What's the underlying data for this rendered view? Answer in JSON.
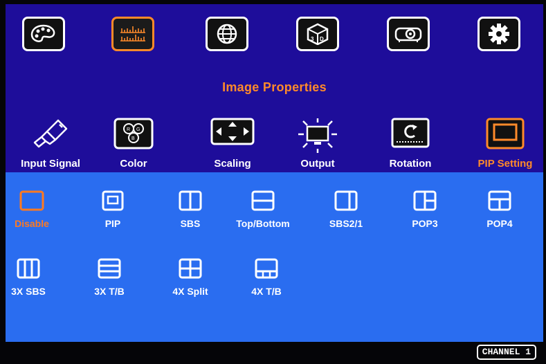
{
  "top_menu": [
    {
      "name": "palette-icon"
    },
    {
      "name": "image-adjust-icon",
      "active": true
    },
    {
      "name": "globe-icon"
    },
    {
      "name": "cube-3d-icon"
    },
    {
      "name": "projector-icon"
    },
    {
      "name": "gear-icon"
    }
  ],
  "section_title": "Image Properties",
  "categories": [
    {
      "label": "Input Signal",
      "icon": "usb-cable-icon"
    },
    {
      "label": "Color",
      "icon": "rgb-circles-icon"
    },
    {
      "label": "Scaling",
      "icon": "scaling-arrows-icon"
    },
    {
      "label": "Output",
      "icon": "monitor-glow-icon"
    },
    {
      "label": "Rotation",
      "icon": "rotation-icon"
    },
    {
      "label": "PIP Setting",
      "icon": "pip-frame-icon",
      "active": true
    }
  ],
  "pip_options_row1": [
    {
      "label": "Disable",
      "icon": "layout-disable-icon",
      "active": true
    },
    {
      "label": "PIP",
      "icon": "layout-pip-icon"
    },
    {
      "label": "SBS",
      "icon": "layout-sbs-icon"
    },
    {
      "label": "Top/Bottom",
      "icon": "layout-top-bottom-icon"
    },
    {
      "label": "SBS2/1",
      "icon": "layout-sbs21-icon"
    },
    {
      "label": "POP3",
      "icon": "layout-pop3-icon"
    },
    {
      "label": "POP4",
      "icon": "layout-pop4-icon"
    }
  ],
  "pip_options_row2": [
    {
      "label": "3X SBS",
      "icon": "layout-3x-sbs-icon"
    },
    {
      "label": "3X T/B",
      "icon": "layout-3x-tb-icon"
    },
    {
      "label": "4X Split",
      "icon": "layout-4x-split-icon"
    },
    {
      "label": "4X T/B",
      "icon": "layout-4x-tb-icon"
    }
  ],
  "status": {
    "channel": "CHANNEL 1"
  },
  "colors": {
    "top_bg": "#1e0d9a",
    "bottom_bg": "#2a6df0",
    "accent": "#ff8a2a"
  }
}
